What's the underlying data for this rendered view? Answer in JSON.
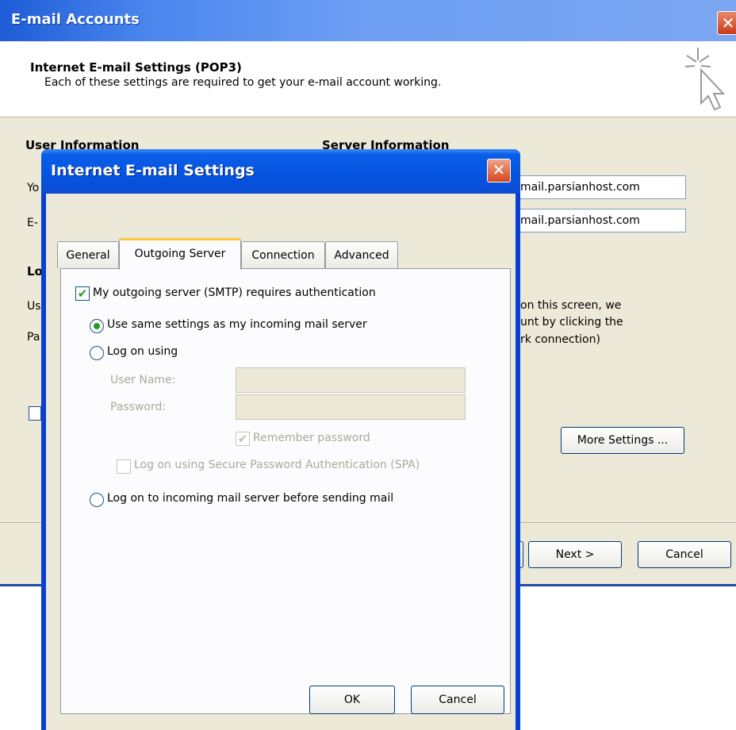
{
  "background_window": {
    "title": "E-mail Accounts",
    "close_glyph": "✕",
    "header_title": "Internet E-mail Settings (POP3)",
    "header_subtitle": "Each of these settings are required to get your e-mail account working.",
    "user_info_heading": "User Information",
    "server_info_heading": "Server Information",
    "partial_your_name": "Yo",
    "partial_email": "E-",
    "partial_logon": "Lo",
    "partial_user": "Us",
    "partial_password": "Pa",
    "incoming_server_value": "mail.parsianhost.com",
    "outgoing_server_value": "mail.parsianhost.com",
    "test_text_line1": "on this screen, we",
    "test_text_line2": "unt by clicking the",
    "test_text_line3": "rk connection)",
    "more_settings_button": "More Settings ...",
    "next_button": "Next >",
    "cancel_button": "Cancel"
  },
  "dialog": {
    "title": "Internet E-mail Settings",
    "close_glyph": "✕",
    "tabs": [
      "General",
      "Outgoing Server",
      "Connection",
      "Advanced"
    ],
    "active_tab": "Outgoing Server",
    "smtp_auth_label": "My outgoing server (SMTP) requires authentication",
    "smtp_auth_checked": true,
    "radio_same_settings": "Use same settings as my incoming mail server",
    "radio_log_on_using": "Log on using",
    "user_name_label": "User Name:",
    "user_name_value": "",
    "password_label": "Password:",
    "password_value": "",
    "remember_password_label": "Remember password",
    "remember_password_checked": true,
    "spa_label": "Log on using Secure Password Authentication (SPA)",
    "spa_checked": false,
    "radio_log_on_incoming": "Log on to incoming mail server before sending mail",
    "selected_radio": "Use same settings as my incoming mail server",
    "ok_button": "OK",
    "cancel_button": "Cancel",
    "check_glyph": "✔"
  },
  "colors": {
    "xp_title_blue": "#0454e0",
    "dialog_face": "#ece9d8",
    "checkmark_green": "#21a121",
    "active_tab_accent": "#ffc73c",
    "close_red": "#d3461f"
  },
  "icons": [
    "close-icon",
    "wizard-cursor-icon",
    "checkmark-icon",
    "radio-dot-icon"
  ]
}
